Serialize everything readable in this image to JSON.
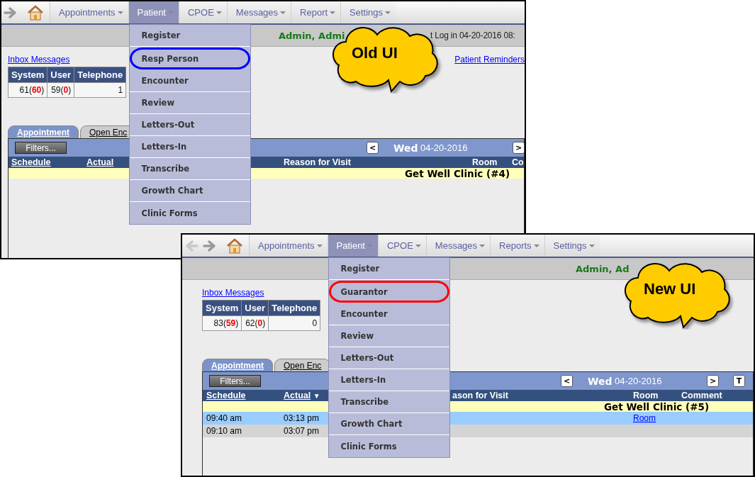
{
  "windows": [
    {
      "nav_arrows": [
        {
          "kind": "forward",
          "disabled": false
        }
      ],
      "menus": [
        {
          "label": "Appointments",
          "selected": false
        },
        {
          "label": "Patient",
          "selected": true
        },
        {
          "label": "CPOE",
          "selected": false
        },
        {
          "label": "Messages",
          "selected": false
        },
        {
          "label": "Report",
          "selected": false
        },
        {
          "label": "Settings",
          "selected": false
        }
      ],
      "dropdown": [
        {
          "label": "Register",
          "circled": false
        },
        {
          "label": "Resp Person",
          "circled": true
        },
        {
          "label": "Encounter",
          "circled": false
        },
        {
          "label": "Review",
          "circled": false
        },
        {
          "label": "Letters-Out",
          "circled": false
        },
        {
          "label": "Letters-In",
          "circled": false
        },
        {
          "label": "Transcribe",
          "circled": false
        },
        {
          "label": "Growth Chart",
          "circled": false
        },
        {
          "label": "Clinic Forms",
          "circled": false
        }
      ],
      "color": "#0000ff",
      "user_bar": {
        "user": "Admin, Admi",
        "login": "t Log in 04-20-2016 08:"
      },
      "inbox_link": "Inbox Messages",
      "reminders_link": "Patient Reminders",
      "counts": {
        "columns": [
          "System",
          "User",
          "Telephone"
        ],
        "values": [
          {
            "before": "61(",
            "alert": "60",
            "after": ")"
          },
          {
            "before": "59(",
            "alert": "0",
            "after": ")"
          },
          {
            "before": "1"
          }
        ]
      },
      "tabs": [
        {
          "label": "Appointment",
          "selected": true
        },
        {
          "label": "Open Enc",
          "selected": false
        }
      ],
      "date_bar": {
        "filter_button": "Filters...",
        "prev": "<",
        "day": "Wed",
        "date": "04-20-2016",
        "next": ">"
      },
      "columns": [
        {
          "label": "Schedule",
          "link": true
        },
        {
          "label": "Actual",
          "link": true
        },
        {
          "label": "Reason for Visit",
          "link": false
        },
        {
          "label": "Room",
          "link": false
        },
        {
          "label": "Co",
          "link": false
        }
      ],
      "group_row": "Get Well Clinic (#4)",
      "callout": "Old UI"
    },
    {
      "nav_arrows": [
        {
          "kind": "back",
          "disabled": true
        },
        {
          "kind": "forward",
          "disabled": false
        }
      ],
      "menus": [
        {
          "label": "Appointments",
          "selected": false
        },
        {
          "label": "Patient",
          "selected": true
        },
        {
          "label": "CPOE",
          "selected": false
        },
        {
          "label": "Messages",
          "selected": false
        },
        {
          "label": "Reports",
          "selected": false
        },
        {
          "label": "Settings",
          "selected": false
        }
      ],
      "dropdown": [
        {
          "label": "Register",
          "circled": false
        },
        {
          "label": "Guarantor",
          "circled": true
        },
        {
          "label": "Encounter",
          "circled": false
        },
        {
          "label": "Review",
          "circled": false
        },
        {
          "label": "Letters-Out",
          "circled": false
        },
        {
          "label": "Letters-In",
          "circled": false
        },
        {
          "label": "Transcribe",
          "circled": false
        },
        {
          "label": "Growth Chart",
          "circled": false
        },
        {
          "label": "Clinic Forms",
          "circled": false
        }
      ],
      "color": "#ff0000",
      "user_bar": {
        "user": "Admin, Ad"
      },
      "inbox_link": "Inbox Messages",
      "counts": {
        "columns": [
          "System",
          "User",
          "Telephone"
        ],
        "values": [
          {
            "before": "83(",
            "alert": "59",
            "after": ")"
          },
          {
            "before": "62(",
            "alert": "0",
            "after": ")"
          },
          {
            "before": "0"
          }
        ]
      },
      "tabs": [
        {
          "label": "Appointment",
          "selected": true
        },
        {
          "label": "Open Enc",
          "selected": false
        }
      ],
      "date_bar": {
        "filter_button": "Filters...",
        "prev": "<",
        "day": "Wed",
        "date": "04-20-2016",
        "next": ">",
        "today": "T"
      },
      "columns": [
        {
          "label": "Schedule",
          "link": true
        },
        {
          "label": "Actual",
          "link": true,
          "sort": "▼"
        },
        {
          "label": "ason for Visit",
          "link": false
        },
        {
          "label": "Room",
          "link": false
        },
        {
          "label": "Comment",
          "link": false
        }
      ],
      "group_row": "Get Well Clinic (#5)",
      "rows": [
        {
          "schedule": "09:40 am",
          "actual": "03:13 pm",
          "room": "Room",
          "selected": true
        },
        {
          "schedule": "09:10 am",
          "actual": "03:07 pm",
          "selected": false
        }
      ],
      "callout": "New UI"
    }
  ]
}
